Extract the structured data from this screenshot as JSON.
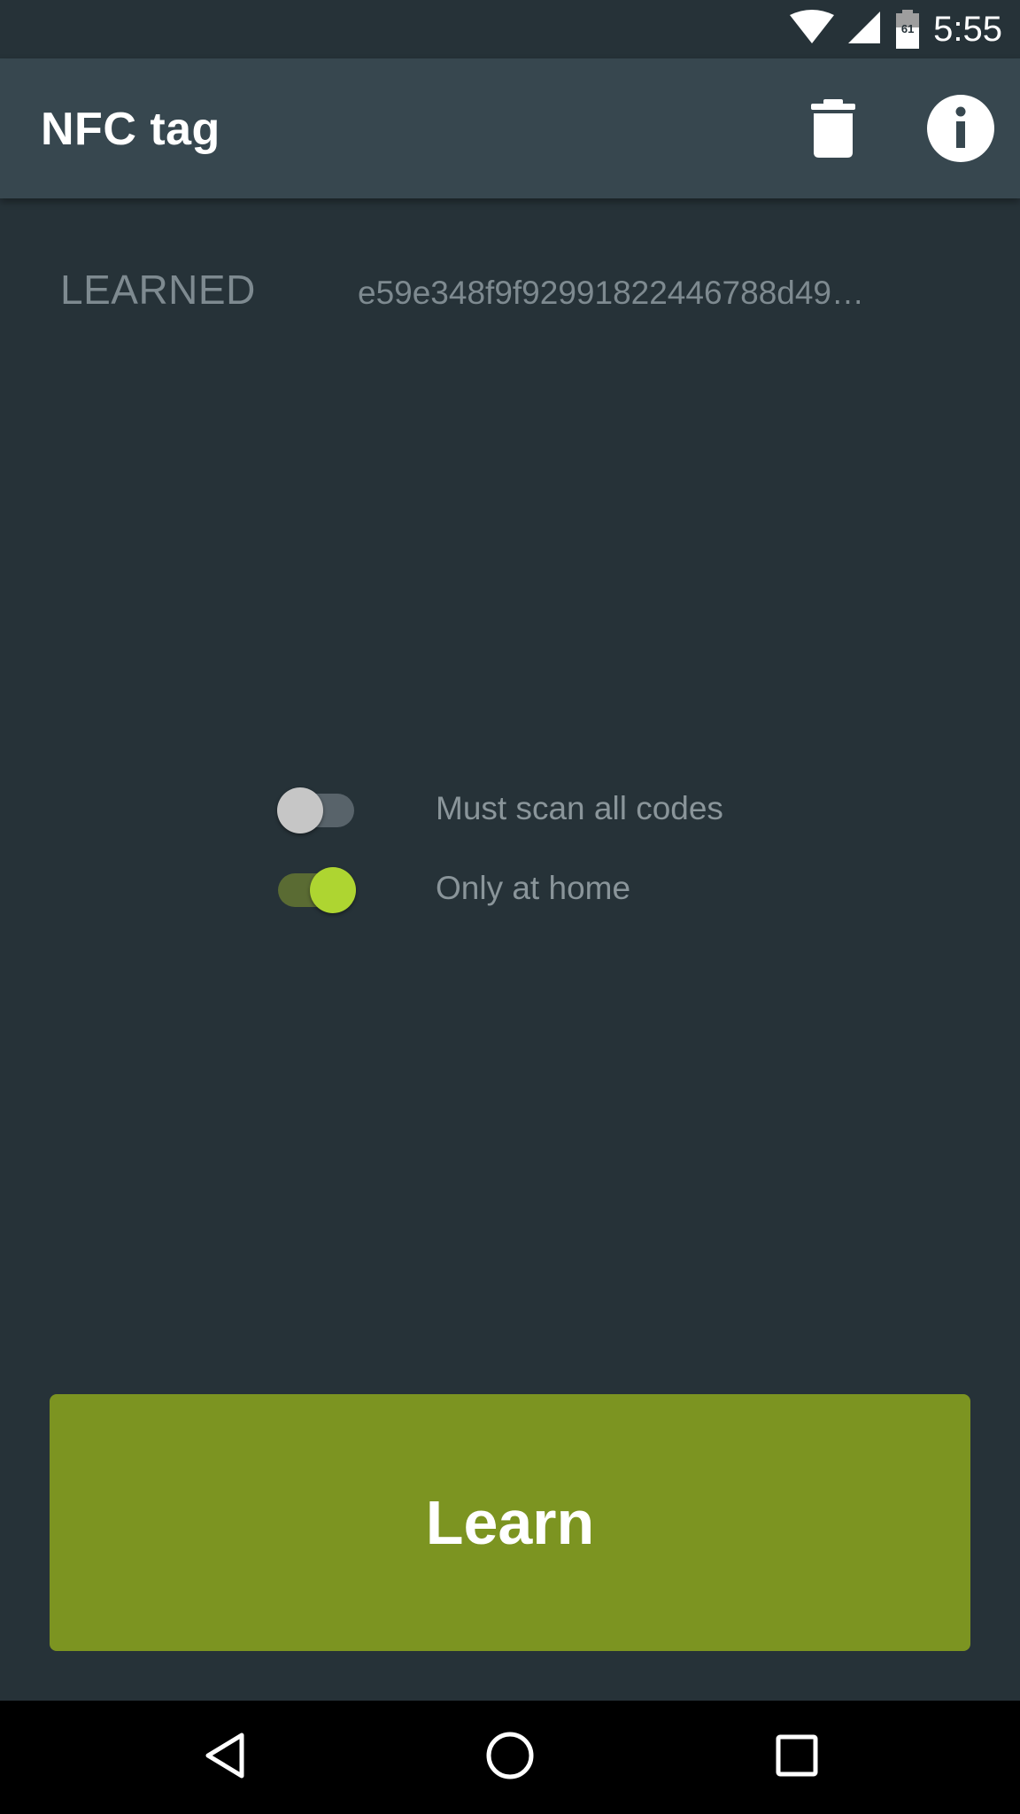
{
  "status_bar": {
    "time": "5:55",
    "battery_level": "61",
    "icons": [
      "wifi-icon",
      "cell-signal-icon",
      "battery-icon"
    ]
  },
  "app_bar": {
    "title": "NFC tag",
    "actions": [
      {
        "icon": "trash-icon",
        "label": "Delete"
      },
      {
        "icon": "info-icon",
        "label": "Info"
      }
    ]
  },
  "learned": {
    "label": "LEARNED",
    "value": "e59e348f9f92991822446788d49…"
  },
  "options": [
    {
      "label": "Must scan all codes",
      "enabled": false
    },
    {
      "label": "Only at home",
      "enabled": true
    }
  ],
  "learn_button": {
    "label": "Learn"
  },
  "nav_bar": {
    "buttons": [
      "back-icon",
      "home-icon",
      "recents-icon"
    ]
  },
  "colors": {
    "background": "#263238",
    "app_bar": "#37474f",
    "accent": "#aed531",
    "button": "#7c9421",
    "muted_text": "#7e8a90"
  }
}
